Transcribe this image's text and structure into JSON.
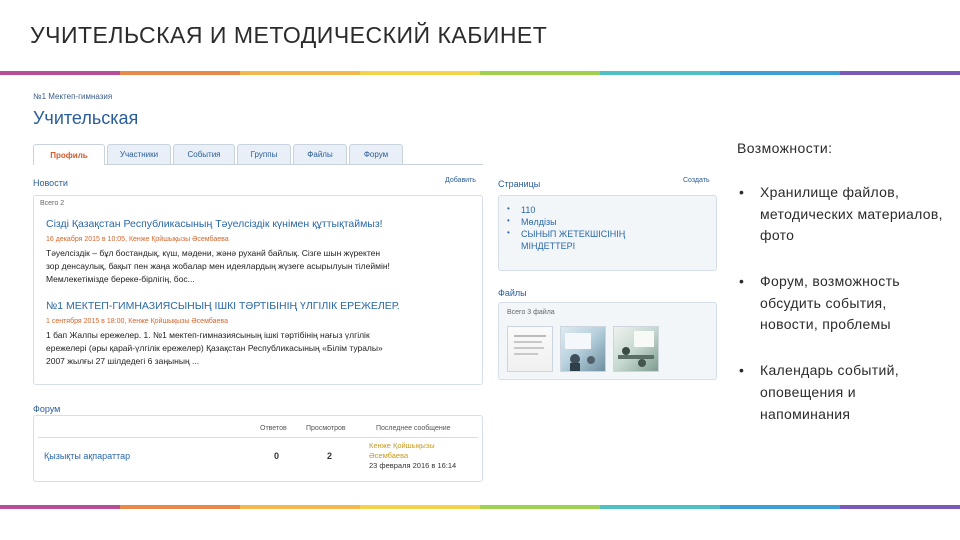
{
  "slide": {
    "title": "УЧИТЕЛЬСКАЯ И МЕТОДИЧЕСКИЙ КАБИНЕТ",
    "stripe_colors": [
      "#b84d9a",
      "#e8894a",
      "#f2b84b",
      "#f2d34b",
      "#9fd14e",
      "#4ec0c6",
      "#3d9fd8",
      "#7a59b8"
    ]
  },
  "site": {
    "school": "№1 Мектеп-гимназия",
    "page_title": "Учительская",
    "tabs": [
      {
        "label": "Профиль",
        "active": true
      },
      {
        "label": "Участники",
        "active": false
      },
      {
        "label": "События",
        "active": false
      },
      {
        "label": "Группы",
        "active": false
      },
      {
        "label": "Файлы",
        "active": false
      },
      {
        "label": "Форум",
        "active": false
      }
    ],
    "news": {
      "heading": "Новости",
      "add_label": "Добавить",
      "count": "Всего 2",
      "items": [
        {
          "title": "Сізді Қазақстан Республикасының Тәуелсіздік күнімен құттықтаймыз!",
          "meta": "16 декабря 2015 в 10:05, Кенже Қойшықызы Әсембаева",
          "lines": [
            "Тәуелсіздік – бұл бостандық, күш, мәдени, жәнә руханй байлық. Сізге шын жүректен",
            "зор денсаулық, бақыт пен жаңа жобалар мен идеялардың жүзеге асырылуын тілеймін!",
            "Мемлекетімізде береке-бірлігің, бос..."
          ]
        },
        {
          "title": "№1 МЕКТЕП-ГИМНАЗИЯСЫНЫҢ ІШКІ ТӘРТІБІНІҢ ҮЛГІЛІК ЕРЕЖЕЛЕР.",
          "meta": "1 сентября 2015 в 18:00, Кенже Қойшықызы Әсембаева",
          "lines": [
            "1 бап Жалпы ережелер. 1.    №1 мектеп-гимназиясының ішкі тәртібінің  нағыз үлгілік",
            "ережелері (әры қарай-үлгілік ережелер) Қазақстан Республикасының «Білім туралы»",
            "2007 жылғы 27 шілдедегі 6 заңының ..."
          ]
        }
      ]
    },
    "pages": {
      "heading": "Страницы",
      "create_label": "Создать",
      "items": [
        {
          "line1": "110",
          "line2": ""
        },
        {
          "line1": "Мөлдізы",
          "line2": ""
        },
        {
          "line1": "СЫНЫП ЖЕТЕКШІСІНІҢ",
          "line2": "МІНДЕТТЕРІ"
        }
      ]
    },
    "files": {
      "heading": "Файлы",
      "count": "Всего 3 файла",
      "thumbs": [
        "document-thumbnail",
        "presentation-photo-thumbnail",
        "classroom-photo-thumbnail"
      ]
    },
    "forum": {
      "heading": "Форум",
      "col_replies": "Ответов",
      "col_views": "Просмотров",
      "col_last": "Последнее сообщение",
      "row": {
        "name": "Қызықты ақпараттар",
        "replies": "0",
        "views": "2",
        "last_author_1": "Кенже Қойшықызы",
        "last_author_2": "Әсембаева",
        "last_date": "23 февраля 2016 в 16:14"
      }
    }
  },
  "features": {
    "title": "Возможности:",
    "items": [
      "Хранилище файлов, методических материалов, фото",
      "Форум, возможность обсудить события, новости, проблемы",
      "Календарь событий, оповещения и напоминания"
    ]
  }
}
